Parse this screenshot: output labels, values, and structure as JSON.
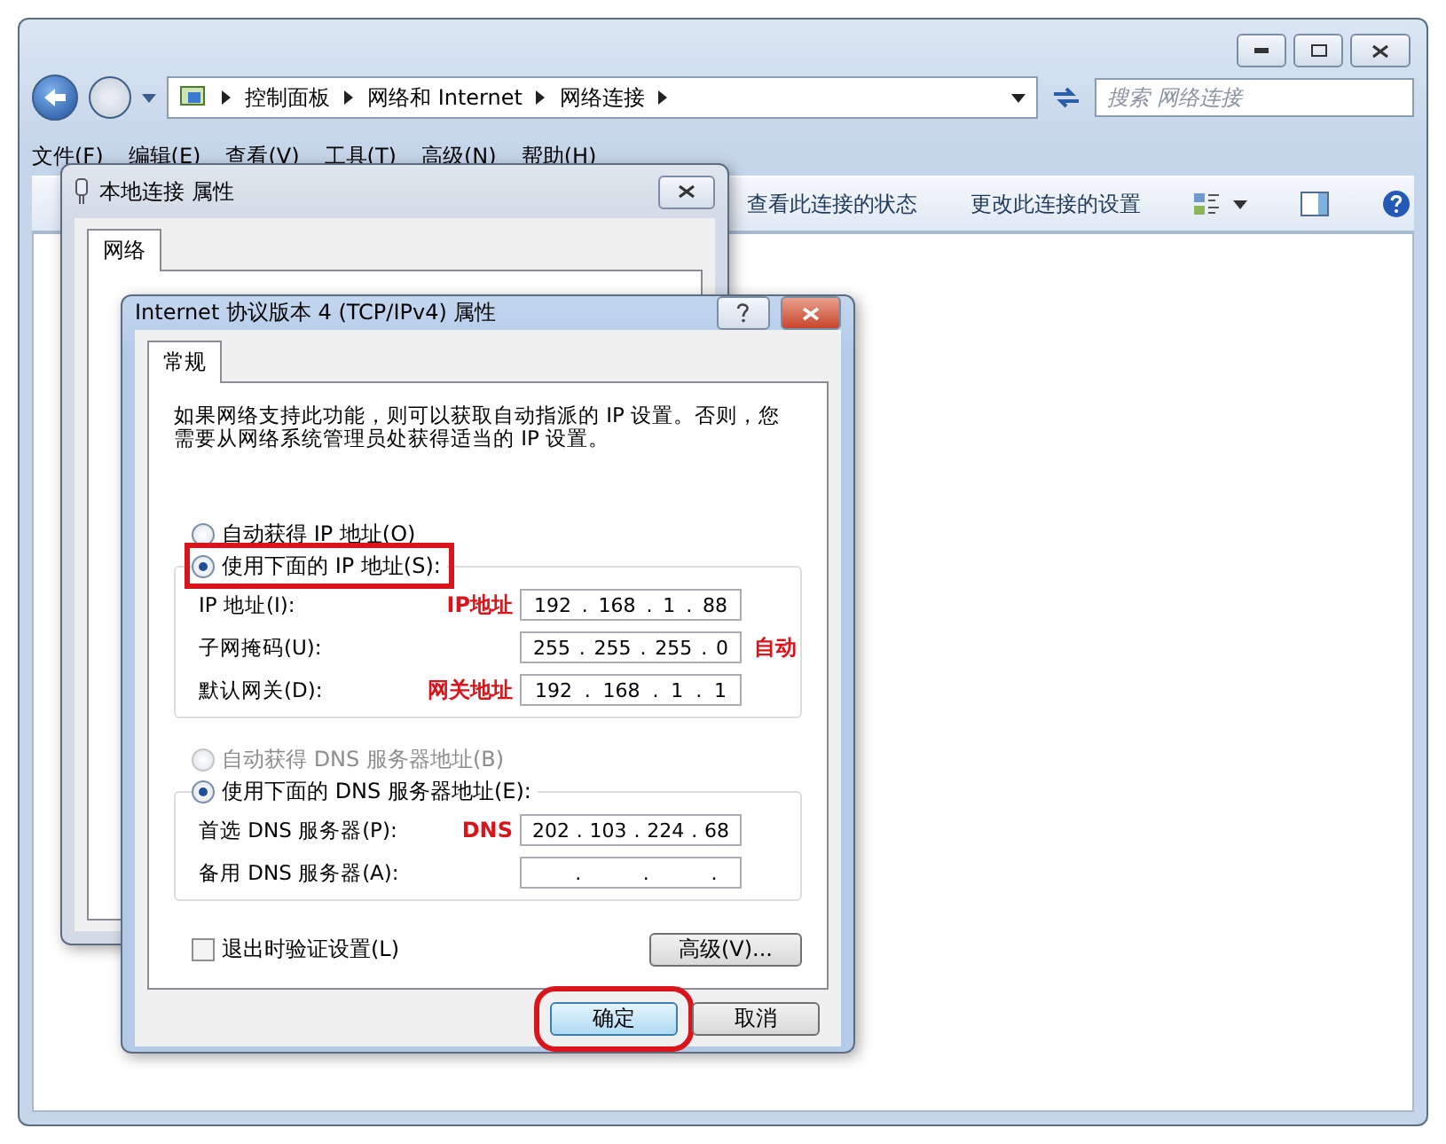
{
  "explorer": {
    "address_segments": [
      "控制面板",
      "网络和 Internet",
      "网络连接"
    ],
    "search": {
      "placeholder": "搜索 网络连接"
    },
    "menu": [
      "文件(F)",
      "编辑(E)",
      "查看(V)",
      "工具(T)",
      "高级(N)",
      "帮助(H)"
    ],
    "commands": [
      "查看此连接的状态",
      "更改此连接的设置"
    ]
  },
  "back_dialog": {
    "title": "本地连接 属性",
    "tabs": [
      {
        "label": "网络",
        "selected": true
      }
    ]
  },
  "dialog": {
    "title": "Internet 协议版本 4 (TCP/IPv4) 属性",
    "tabs": [
      {
        "label": "常规",
        "selected": true
      }
    ],
    "description": "如果网络支持此功能，则可以获取自动指派的 IP 设置。否则，您需要从网络系统管理员处获得适当的 IP 设置。",
    "ip_options": [
      {
        "label": "自动获得 IP 地址(O)",
        "selected": false,
        "disabled": false,
        "highlighted": false
      },
      {
        "label": "使用下面的 IP 地址(S):",
        "selected": true,
        "disabled": false,
        "highlighted": true
      }
    ],
    "ip_fields": [
      {
        "label": "IP 地址(I):",
        "octets": [
          "192",
          "168",
          "1",
          "88"
        ],
        "dots": [
          ".",
          ".",
          "."
        ],
        "note_left": "IP地址"
      },
      {
        "label": "子网掩码(U):",
        "octets": [
          "255",
          "255",
          "255",
          "0"
        ],
        "dots": [
          ".",
          ".",
          "."
        ],
        "note_right": "自动"
      },
      {
        "label": "默认网关(D):",
        "octets": [
          "192",
          "168",
          "1",
          "1"
        ],
        "dots": [
          ".",
          ".",
          "."
        ],
        "note_left": "网关地址"
      }
    ],
    "dns_options": [
      {
        "label": "自动获得 DNS 服务器地址(B)",
        "selected": false,
        "disabled": true,
        "highlighted": false
      },
      {
        "label": "使用下面的 DNS 服务器地址(E):",
        "selected": true,
        "disabled": false,
        "highlighted": false
      }
    ],
    "dns_fields": [
      {
        "label": "首选 DNS 服务器(P):",
        "octets": [
          "202",
          "103",
          "224",
          "68"
        ],
        "dots": [
          ".",
          ".",
          "."
        ],
        "note_left": "DNS"
      },
      {
        "label": "备用 DNS 服务器(A):",
        "dots": [
          ".",
          ".",
          "."
        ]
      }
    ],
    "validate": {
      "label": "退出时验证设置(L)",
      "checked": false
    },
    "advanced_button": "高级(V)...",
    "buttons": [
      {
        "label": "确定",
        "default": true,
        "highlighted": true
      },
      {
        "label": "取消",
        "default": false,
        "highlighted": false
      }
    ]
  }
}
